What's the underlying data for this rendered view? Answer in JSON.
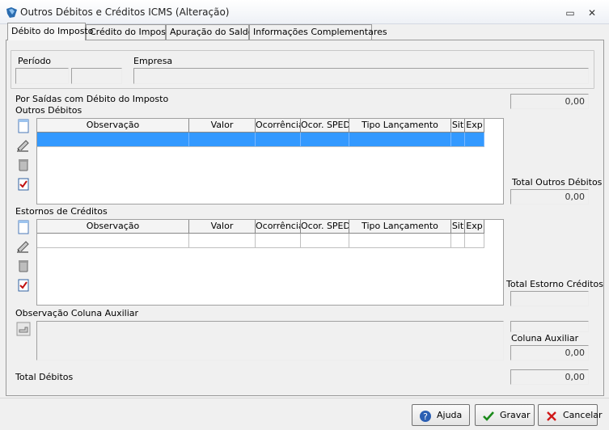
{
  "window": {
    "title": "Outros Débitos e Créditos ICMS (Alteração)",
    "minimize_glyph": "▭",
    "close_glyph": "✕"
  },
  "tabs": [
    {
      "label": "Débito do Imposto"
    },
    {
      "label": "Crédito do Imposto"
    },
    {
      "label": "Apuração do Saldo"
    },
    {
      "label": "Informações Complementares"
    }
  ],
  "header": {
    "periodo_label": "Período",
    "empresa_label": "Empresa",
    "periodo_value_1": "",
    "periodo_value_2": "",
    "empresa_value": ""
  },
  "section": {
    "title": "Por Saídas com Débito do Imposto",
    "top_total_value": "0,00"
  },
  "outros_debitos": {
    "label": "Outros Débitos",
    "total_label": "Total Outros Débitos",
    "total_value": "0,00"
  },
  "estornos": {
    "label": "Estornos de Créditos",
    "total_label": "Total Estorno Créditos",
    "total_value": ""
  },
  "grid_columns": [
    "Observação",
    "Valor",
    "Ocorrência",
    "Ocor. SPED",
    "Tipo Lançamento",
    "Sit",
    "Exp"
  ],
  "observacao": {
    "label": "Observação Coluna Auxiliar",
    "coluna_label": "Coluna Auxiliar",
    "coluna_value": "0,00",
    "coluna_top_value": ""
  },
  "total_debitos": {
    "label": "Total Débitos",
    "value": "0,00"
  },
  "buttons": {
    "ajuda": "Ajuda",
    "gravar": "Gravar",
    "cancelar": "Cancelar"
  },
  "icons": {
    "new": "new-record-icon",
    "edit": "edit-record-icon",
    "delete": "delete-record-icon",
    "check": "check-record-icon",
    "pointer": "hand-pointer-icon"
  },
  "colors": {
    "selection": "#3399ff",
    "background": "#f0f0f0"
  }
}
